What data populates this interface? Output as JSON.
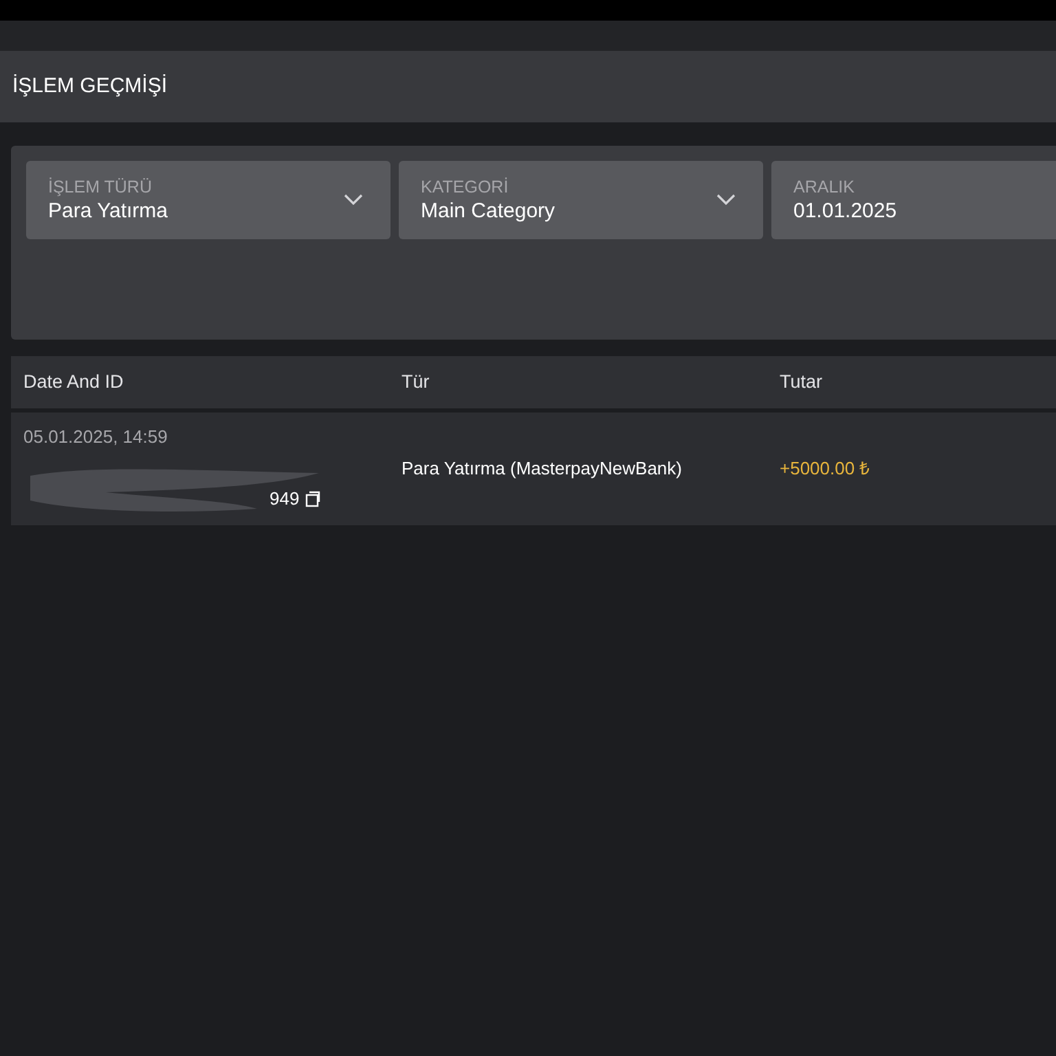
{
  "page_title": "İŞLEM GEÇMİŞİ",
  "filters": [
    {
      "kind": "dropdown",
      "label": "İŞLEM TÜRÜ",
      "value": "Para Yatırma"
    },
    {
      "kind": "dropdown",
      "label": "KATEGORİ",
      "value": "Main Category"
    },
    {
      "kind": "date",
      "label": "ARALIK",
      "value": "01.01.2025"
    }
  ],
  "table": {
    "columns": [
      "Date And ID",
      "Tür",
      "Tutar"
    ],
    "rows": [
      {
        "date": "05.01.2025, 14:59",
        "id_visible": "949",
        "type": "Para Yatırma (MasterpayNewBank)",
        "amount": "+5000.00 ₺"
      }
    ]
  }
}
